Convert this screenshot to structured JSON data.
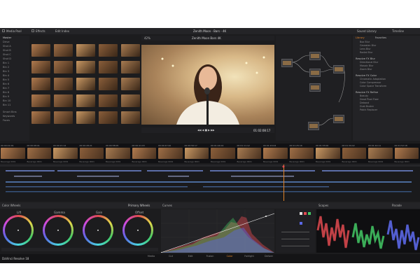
{
  "app_title": "Zenith Moon - Bars - 4K",
  "top_tabs": [
    "Media Pool",
    "Effects",
    "Edit Index",
    "Sound Library",
    "Timeline"
  ],
  "viewer": {
    "name": "Zenith Moon Bars 4K",
    "timecode": "01:02:08:17",
    "zoom": "42%"
  },
  "filmstrip": {
    "timecodes": [
      "00:00:01:09",
      "00:00:08:01",
      "00:00:21:14",
      "00:00:28:21",
      "00:00:38:05",
      "00:00:41:03",
      "00:00:47:00",
      "00:00:56:17",
      "00:01:04:04",
      "00:01:11:12",
      "00:01:20:04",
      "00:01:25:16",
      "00:01:33:00",
      "00:01:39:02",
      "00:01:44:11",
      "00:01:52:18"
    ],
    "caption": "Beverage 0001"
  },
  "color_wheels": {
    "title": "Color Wheels",
    "mode": "Primary Wheels",
    "wheels": [
      "Lift",
      "Gamma",
      "Gain",
      "Offset"
    ]
  },
  "curves": {
    "title": "Curves"
  },
  "scopes": {
    "title": "Scopes",
    "mode": "Parade"
  },
  "library": {
    "headers": [
      "Library",
      "Favorites"
    ],
    "sections": [
      "Resolve FX Blur",
      "Resolve FX Color",
      "Resolve FX Refine"
    ]
  },
  "bottom_pages": [
    "Media",
    "Cut",
    "Edit",
    "Fusion",
    "Color",
    "Fairlight",
    "Deliver"
  ],
  "product_label": "DaVinci Resolve 18",
  "colors": {
    "accent": "#e0832a",
    "panel": "#1c1c1e",
    "red": "#e04a50",
    "green": "#43c965",
    "blue": "#5b67e6"
  }
}
